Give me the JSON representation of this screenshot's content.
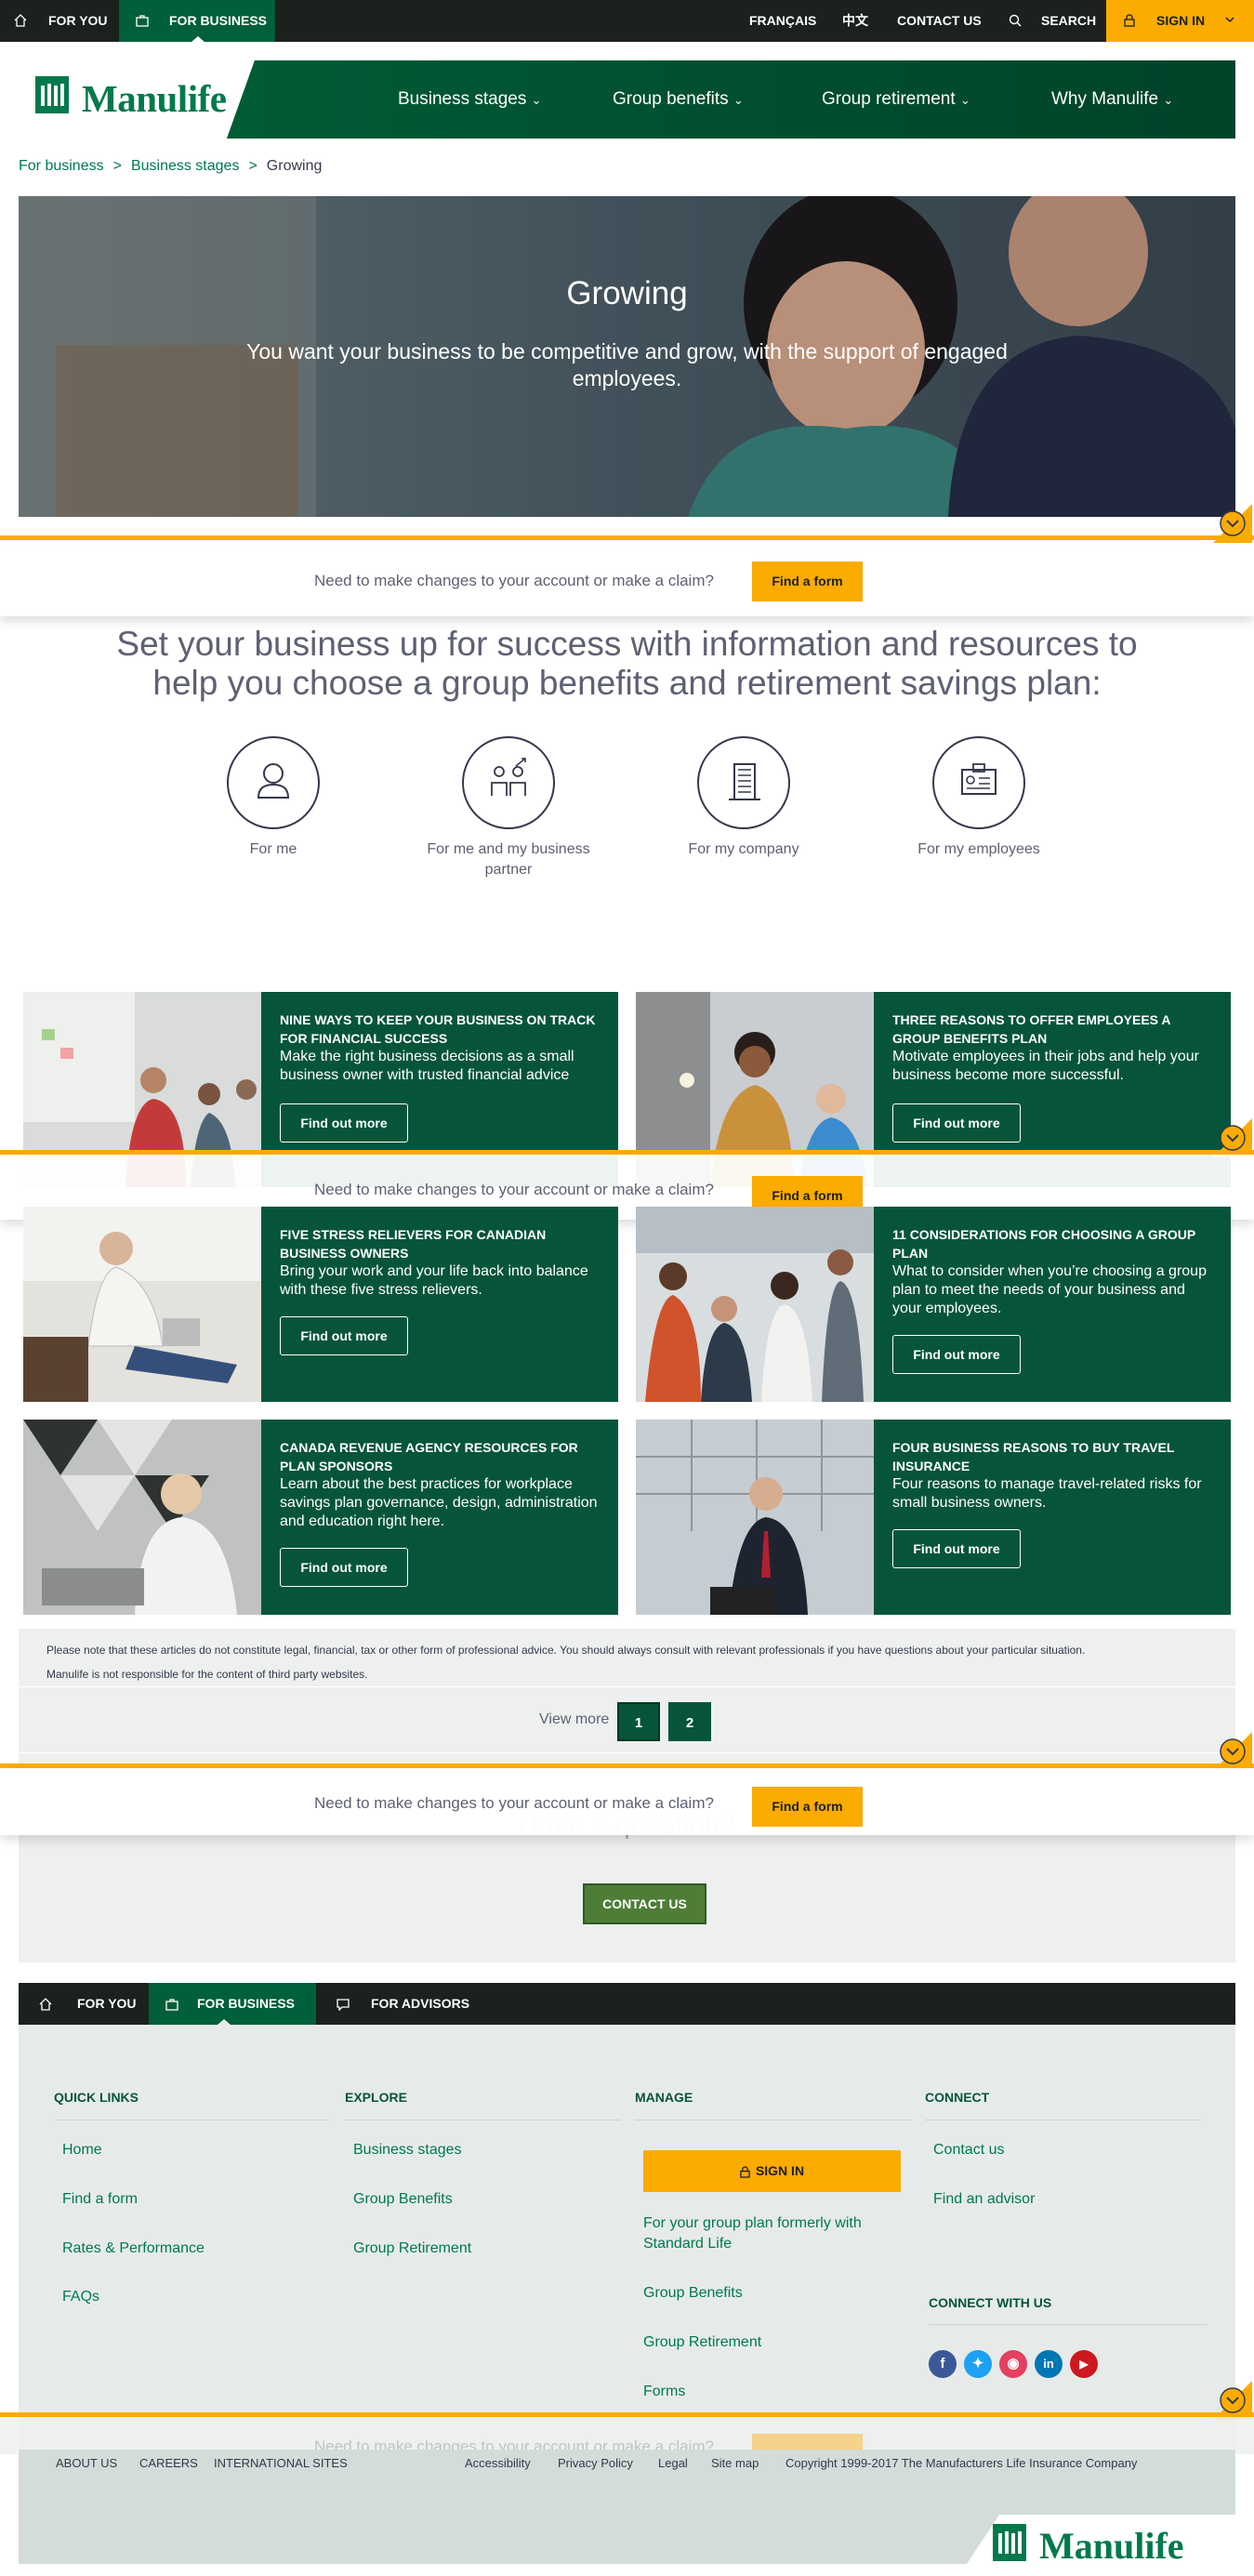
{
  "topbar": {
    "for_you": "FOR YOU",
    "for_business": "FOR BUSINESS",
    "francais": "FRANÇAIS",
    "chinese": "中文",
    "contact_us": "CONTACT US",
    "search": "SEARCH",
    "sign_in": "SIGN IN"
  },
  "logo": {
    "text": "Manulife"
  },
  "nav": [
    "Business stages",
    "Group benefits",
    "Group retirement",
    "Why Manulife"
  ],
  "breadcrumb": {
    "home": "For business",
    "parent": "Business stages",
    "current": "Growing",
    "sep": ">"
  },
  "hero": {
    "title": "Growing",
    "subtitle": "You want your business to be competitive and grow, with the support of engaged employees."
  },
  "claim": {
    "question": "Need to make changes to your account or make a claim?",
    "button": "Find a form"
  },
  "intro": "Set your business up for success with information and resources to help you choose a group benefits and retirement savings plan:",
  "audiences": [
    "For me",
    "For me and my business partner",
    "For my company",
    "For my employees"
  ],
  "cards": [
    {
      "title": "Nine ways to keep your business on track for financial success",
      "desc": "Make the right business decisions as a small business owner with trusted financial advice",
      "button": "Find out more"
    },
    {
      "title": "Three reasons to offer employees a group benefits plan",
      "desc": "Motivate employees in their jobs and help your business become more successful.",
      "button": "Find out more"
    },
    {
      "title": "Five stress relievers for Canadian business owners",
      "desc": "Bring your work and your life back into balance with these five stress relievers.",
      "button": "Find out more"
    },
    {
      "title": "11 considerations for choosing a group plan",
      "desc": "What to consider when you’re choosing a group plan to meet the needs of your business and your employees.",
      "button": "Find out more"
    },
    {
      "title": "Canada Revenue Agency resources for plan sponsors",
      "desc": "Learn about the best practices for workplace savings plan governance, design, administration and education right here.",
      "button": "Find out more"
    },
    {
      "title": "Four business reasons to buy travel insurance",
      "desc": "Four reasons to manage travel-related risks for small business owners.",
      "button": "Find out more"
    }
  ],
  "disclaimer": {
    "line1": "Please note that these articles do not constitute legal, financial, tax or other form of professional advice. You should always consult with relevant professionals if you have questions about your particular situation.",
    "line2": "Manulife is not responsible for the content of third party websites."
  },
  "viewmore": {
    "label": "View more",
    "pages": [
      "1",
      "2"
    ]
  },
  "question": {
    "title": "Have a question?",
    "button": "CONTACT US"
  },
  "footerbar": {
    "for_you": "FOR YOU",
    "for_business": "FOR BUSINESS",
    "for_advisors": "FOR ADVISORS"
  },
  "footer": {
    "quick_links": {
      "title": "Quick links",
      "items": [
        "Home",
        "Find a form",
        "Rates & Performance",
        "FAQs"
      ]
    },
    "explore": {
      "title": "Explore",
      "items": [
        "Business stages",
        "Group Benefits",
        "Group Retirement"
      ]
    },
    "manage": {
      "title": "Manage",
      "sign_in": "SIGN IN",
      "items": [
        "For your group plan formerly with Standard Life",
        "Group Benefits",
        "Group Retirement",
        "Forms"
      ]
    },
    "connect": {
      "title": "Connect",
      "items": [
        "Contact us",
        "Find an advisor"
      ],
      "social_title": "Connect with us",
      "social": [
        "f",
        "t",
        "ig",
        "in",
        "yt"
      ]
    }
  },
  "legal": {
    "left": [
      "ABOUT US",
      "CAREERS",
      "INTERNATIONAL SITES"
    ],
    "right": [
      "Accessibility",
      "Privacy Policy",
      "Legal",
      "Site map"
    ],
    "copyright": "Copyright 1999-2017 The Manufacturers Life Insurance Company"
  },
  "colors": {
    "green": "#00794b",
    "dark_green": "#06553a",
    "yellow": "#fcab00",
    "black": "#1b211d"
  }
}
